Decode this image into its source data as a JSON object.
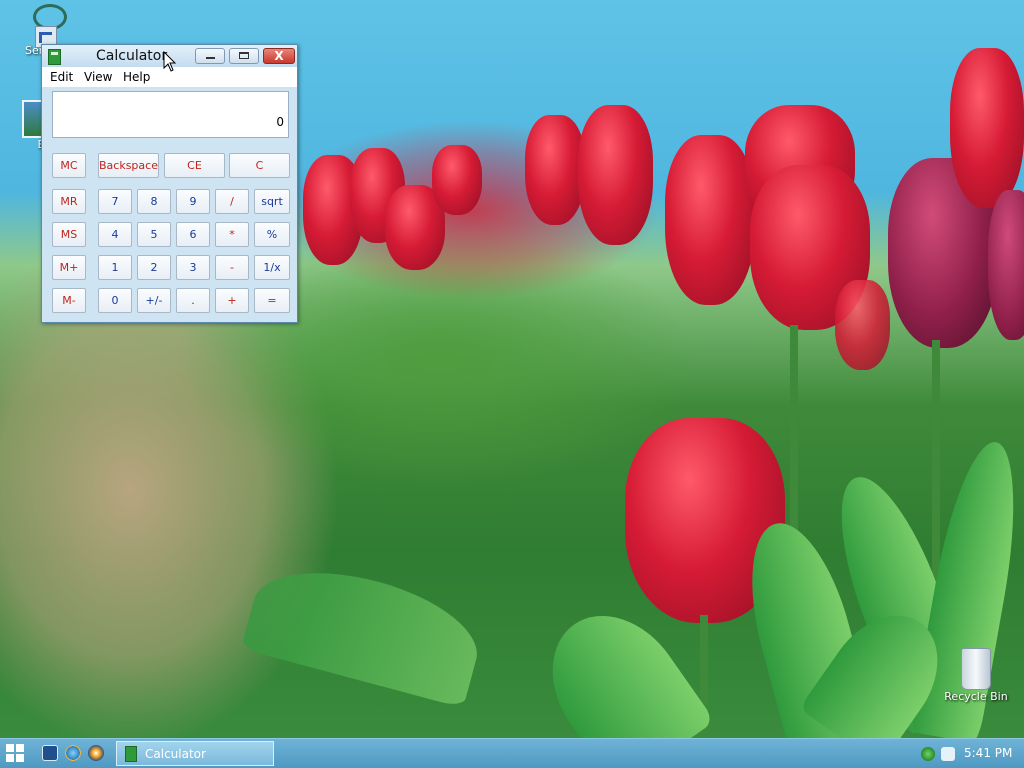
{
  "desktop": {
    "icons": [
      {
        "label": "Serpe",
        "icon": "serpent-app-icon"
      },
      {
        "label": "E",
        "icon": "image-file-icon"
      },
      {
        "label": "Recycle Bin",
        "icon": "recycle-bin-icon"
      }
    ]
  },
  "calculator": {
    "title": "Calculator",
    "menu": [
      "Edit",
      "View",
      "Help"
    ],
    "display": "0",
    "top_buttons": [
      "Backspace",
      "CE",
      "C"
    ],
    "memory_buttons": [
      "MC",
      "MR",
      "MS",
      "M+",
      "M-"
    ],
    "rows": [
      [
        "7",
        "8",
        "9",
        "/",
        "sqrt"
      ],
      [
        "4",
        "5",
        "6",
        "*",
        "%"
      ],
      [
        "1",
        "2",
        "3",
        "-",
        "1/x"
      ],
      [
        "0",
        "+/-",
        ".",
        "+",
        "="
      ]
    ],
    "window_buttons": {
      "close": "X"
    }
  },
  "taskbar": {
    "task_label": "Calculator",
    "clock": "5:41 PM",
    "pinned_icons": [
      "desktop-icon",
      "internet-explorer-icon",
      "media-player-icon"
    ],
    "tray_icons": [
      "security-shield-icon",
      "volume-icon"
    ]
  }
}
